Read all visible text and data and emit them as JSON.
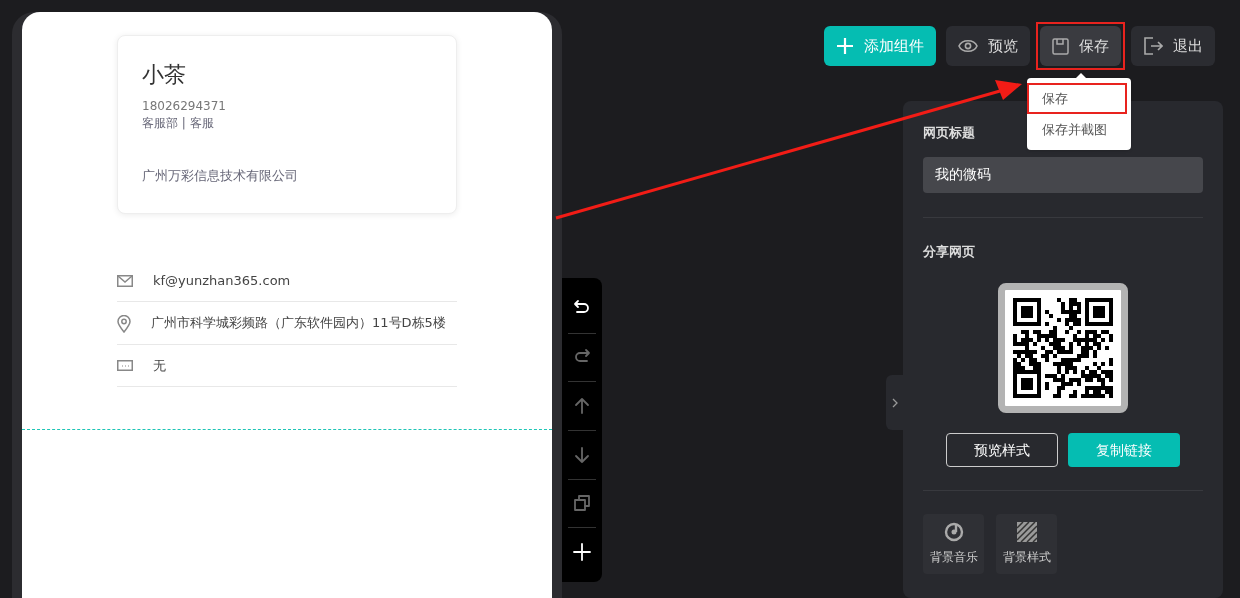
{
  "card": {
    "name": "小茶",
    "phone": "18026294371",
    "department": "客服部 | 客服",
    "company": "广州万彩信息技术有限公司"
  },
  "contacts": [
    {
      "kind": "email",
      "text": "kf@yunzhan365.com"
    },
    {
      "kind": "address",
      "text": "广州市科学城彩频路（广东软件园内）11号D栋5楼"
    },
    {
      "kind": "message",
      "text": "无"
    }
  ],
  "edit_tools": [
    {
      "kind": "undo",
      "disabled": false
    },
    {
      "kind": "redo",
      "disabled": true
    },
    {
      "kind": "up",
      "disabled": true
    },
    {
      "kind": "down",
      "disabled": true
    },
    {
      "kind": "copy",
      "disabled": true
    },
    {
      "kind": "add",
      "disabled": false
    }
  ],
  "top_buttons": [
    {
      "kind": "add",
      "label": "添加组件",
      "highlighted": false
    },
    {
      "kind": "preview",
      "label": "预览",
      "highlighted": false
    },
    {
      "kind": "save",
      "label": "保存",
      "highlighted": true
    },
    {
      "kind": "exit",
      "label": "退出",
      "highlighted": false
    }
  ],
  "save_menu": [
    {
      "label": "保存",
      "highlighted": true
    },
    {
      "label": "保存并截图",
      "highlighted": false
    }
  ],
  "panel": {
    "title_label": "网页标题",
    "title_value": "我的微码",
    "share_label": "分享网页",
    "buttons": [
      {
        "kind": "outline",
        "label": "预览样式"
      },
      {
        "kind": "primary",
        "label": "复制链接"
      }
    ],
    "options": [
      {
        "kind": "music",
        "label": "背景音乐"
      },
      {
        "kind": "pattern",
        "label": "背景样式"
      }
    ]
  }
}
